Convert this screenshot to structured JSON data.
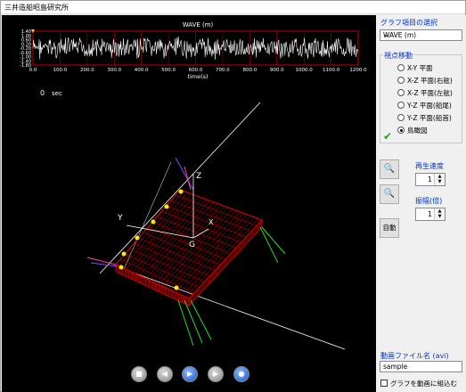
{
  "window": {
    "title": "三井造船昭島研究所"
  },
  "wave": {
    "title": "WAVE (m)",
    "y_ticks": [
      "1.40",
      "1.00",
      "0.60",
      "0.20",
      "-0.20",
      "-0.60",
      "-1.00",
      "-1.40",
      "-1.80"
    ],
    "x_ticks": [
      "0.0",
      "100.0",
      "200.0",
      "300.0",
      "400.0",
      "500.0",
      "600.0",
      "700.0",
      "800.0",
      "900.0",
      "1000.0",
      "1100.0",
      "1200.0"
    ],
    "xlabel": "time(s)"
  },
  "viewer": {
    "time_value": "0",
    "time_unit": "sec",
    "axis_x": "X",
    "axis_y": "Y",
    "axis_z": "Z",
    "axis_g": "G"
  },
  "panel": {
    "graph_select_label": "グラフ項目の選択",
    "graph_selected": "WAVE (m)",
    "viewpoint_label": "視点移動",
    "view_options": [
      "X-Y 平面",
      "X-Z 平面(右舷)",
      "X-Z 平面(左舷)",
      "Y-Z 平面(船尾)",
      "Y-Z 平面(船首)",
      "鳥瞰図"
    ],
    "view_selected": 5,
    "speed_label": "再生速度",
    "speed_value": "1",
    "amp_label": "振幅(倍)",
    "amp_value": "1",
    "auto_label": "自動",
    "movie_label": "動画ファイル名 (avi)",
    "movie_value": "sample",
    "record_label": "グラフを動画に組込む"
  },
  "colors": {
    "background": "#000000",
    "hull": "#e00000",
    "wave_line": "#ffffff",
    "marker": "#ffee00",
    "accent": "#0033cc"
  },
  "icons": {
    "zoom_in": "zoom-in-icon",
    "zoom_out": "zoom-out-icon",
    "stop": "stop-icon",
    "prev": "previous-icon",
    "play": "play-icon",
    "next": "next-icon",
    "record": "record-icon"
  }
}
